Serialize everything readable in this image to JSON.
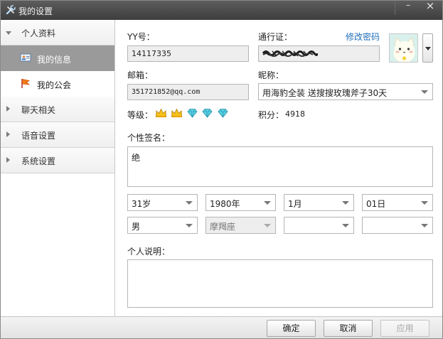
{
  "window": {
    "title": "我的设置"
  },
  "sidebar": {
    "groups": [
      {
        "label": "个人资料",
        "expanded": true
      },
      {
        "label": "聊天相关",
        "expanded": false
      },
      {
        "label": "语音设置",
        "expanded": false
      },
      {
        "label": "系统设置",
        "expanded": false
      }
    ],
    "items": [
      {
        "label": "我的信息",
        "icon": "id-card-icon",
        "active": true
      },
      {
        "label": "我的公会",
        "icon": "flag-icon",
        "active": false
      }
    ]
  },
  "profile": {
    "yy_label": "YY号：",
    "yy_value": "14117335",
    "passport_label": "通行证：",
    "passport_value": "",
    "change_password_label": "修改密码",
    "email_label": "邮箱：",
    "email_value": "351721852@qq.com",
    "nickname_label": "昵称：",
    "nickname_value": "用海豹全装 送搜搜玫瑰斧子30天",
    "level_label": "等级：",
    "level_icons": [
      "crown-icon",
      "crown-icon",
      "diamond-icon",
      "diamond-icon",
      "diamond-icon"
    ],
    "points_label": "积分：",
    "points_value": "4918",
    "signature_label": "个性签名：",
    "signature_value": "绝",
    "age_value": "31岁",
    "year_value": "1980年",
    "month_value": "1月",
    "day_value": "01日",
    "gender_value": "男",
    "zodiac_value": "摩羯座",
    "province_value": "",
    "city_value": "",
    "description_label": "个人说明：",
    "description_value": ""
  },
  "buttons": {
    "ok": "确定",
    "cancel": "取消",
    "apply": "应用"
  },
  "colors": {
    "titlebar": "#4a4a4a",
    "active_item": "#9a9a9a",
    "link": "#1f6eb8"
  }
}
